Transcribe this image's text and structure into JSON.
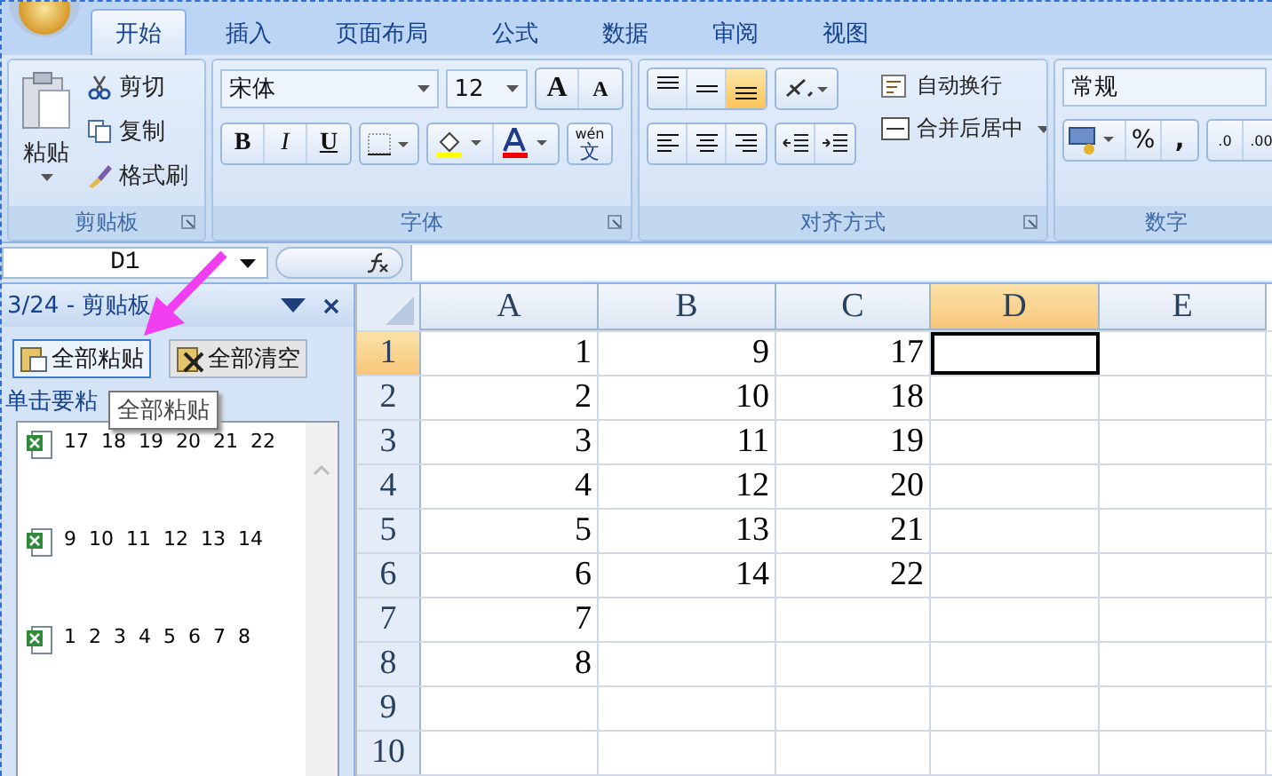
{
  "tabs": [
    {
      "label": "开始",
      "selected": true
    },
    {
      "label": "插入",
      "selected": false
    },
    {
      "label": "页面布局",
      "selected": false
    },
    {
      "label": "公式",
      "selected": false
    },
    {
      "label": "数据",
      "selected": false
    },
    {
      "label": "审阅",
      "selected": false
    },
    {
      "label": "视图",
      "selected": false
    }
  ],
  "clipboard_group": {
    "paste": "粘贴",
    "cut": "剪切",
    "copy": "复制",
    "format_painter": "格式刷",
    "label": "剪贴板"
  },
  "font_group": {
    "font": "宋体",
    "size": "12",
    "grow": "A",
    "shrink": "A",
    "bold": "B",
    "italic": "I",
    "underline": "U",
    "phonetic_top": "wén",
    "phonetic_char": "文",
    "label": "字体"
  },
  "alignment_group": {
    "vertical_align": [
      {
        "kind": "top",
        "selected": false
      },
      {
        "kind": "middle",
        "selected": false
      },
      {
        "kind": "bottom",
        "selected": true
      }
    ],
    "wrap_text": "自动换行",
    "merge_center": "合并后居中",
    "label": "对齐方式"
  },
  "number_group": {
    "format": "常规",
    "percent": "%",
    "comma": ",",
    "increase_decimal": ".0",
    "decrease_decimal": ".00",
    "label": "数字"
  },
  "name_box": "D1",
  "clipboard_pane": {
    "title": "3/24 - 剪贴板",
    "paste_all": "全部粘贴",
    "clear_all": "全部清空",
    "instruction": "单击要粘",
    "tooltip": "全部粘贴",
    "items": [
      "17  18  19  20  21  22",
      "9  10  11  12  13  14",
      "1  2  3  4  5  6  7  8"
    ]
  },
  "sheet": {
    "columns": [
      {
        "label": "A",
        "selected": false
      },
      {
        "label": "B",
        "selected": false
      },
      {
        "label": "C",
        "selected": false
      },
      {
        "label": "D",
        "selected": true
      },
      {
        "label": "E",
        "selected": false
      }
    ],
    "rows": [
      {
        "label": "1",
        "selected": true,
        "cells": [
          "1",
          "9",
          "17",
          "",
          ""
        ]
      },
      {
        "label": "2",
        "selected": false,
        "cells": [
          "2",
          "10",
          "18",
          "",
          ""
        ]
      },
      {
        "label": "3",
        "selected": false,
        "cells": [
          "3",
          "11",
          "19",
          "",
          ""
        ]
      },
      {
        "label": "4",
        "selected": false,
        "cells": [
          "4",
          "12",
          "20",
          "",
          ""
        ]
      },
      {
        "label": "5",
        "selected": false,
        "cells": [
          "5",
          "13",
          "21",
          "",
          ""
        ]
      },
      {
        "label": "6",
        "selected": false,
        "cells": [
          "6",
          "14",
          "22",
          "",
          ""
        ]
      },
      {
        "label": "7",
        "selected": false,
        "cells": [
          "7",
          "",
          "",
          "",
          ""
        ]
      },
      {
        "label": "8",
        "selected": false,
        "cells": [
          "8",
          "",
          "",
          "",
          ""
        ]
      },
      {
        "label": "9",
        "selected": false,
        "cells": [
          "",
          "",
          "",
          "",
          ""
        ]
      },
      {
        "label": "10",
        "selected": false,
        "cells": [
          "",
          "",
          "",
          "",
          ""
        ]
      }
    ]
  }
}
